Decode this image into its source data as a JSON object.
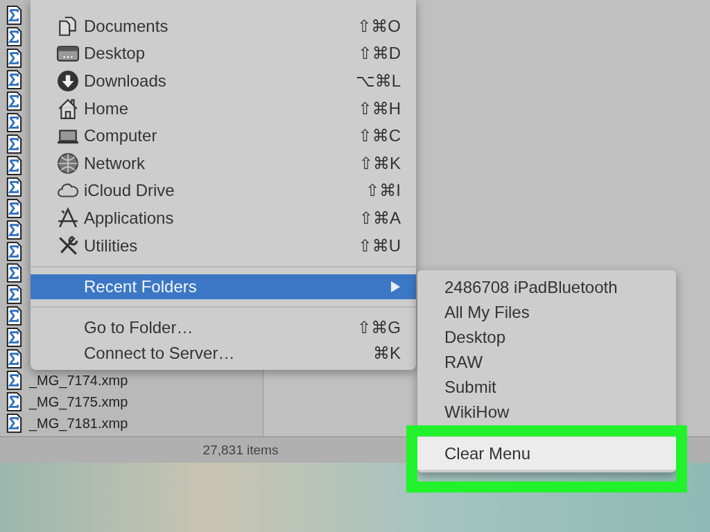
{
  "file_list": {
    "rows": [
      {
        "name": "_MG_7174.xmp"
      },
      {
        "name": "_MG_7175.xmp"
      },
      {
        "name": "_MG_7181.xmp"
      }
    ]
  },
  "status_bar": {
    "text": "27,831 items"
  },
  "go_menu": {
    "sections": [
      [
        {
          "kind": "item",
          "label": "Documents",
          "shortcut": "⇧⌘O",
          "selected": false
        },
        {
          "kind": "item",
          "label": "Desktop",
          "shortcut": "⇧⌘D",
          "selected": false
        },
        {
          "kind": "item",
          "label": "Downloads",
          "shortcut": "⌥⌘L",
          "selected": false
        },
        {
          "kind": "item",
          "label": "Home",
          "shortcut": "⇧⌘H",
          "selected": false
        },
        {
          "kind": "item",
          "label": "Computer",
          "shortcut": "⇧⌘C",
          "selected": false
        },
        {
          "kind": "item",
          "label": "Network",
          "shortcut": "⇧⌘K",
          "selected": false
        },
        {
          "kind": "item",
          "label": "iCloud Drive",
          "shortcut": "⇧⌘I",
          "selected": false
        },
        {
          "kind": "item",
          "label": "Applications",
          "shortcut": "⇧⌘A",
          "selected": false
        },
        {
          "kind": "item",
          "label": "Utilities",
          "shortcut": "⇧⌘U",
          "selected": false
        }
      ],
      [
        {
          "kind": "submenu",
          "label": "Recent Folders",
          "selected": true
        }
      ],
      [
        {
          "kind": "item",
          "label": "Go to Folder…",
          "shortcut": "⇧⌘G",
          "selected": false
        },
        {
          "kind": "item",
          "label": "Connect to Server…",
          "shortcut": "⌘K",
          "selected": false
        }
      ]
    ]
  },
  "recent_folders_menu": {
    "items": [
      {
        "label": "2486708 iPadBluetooth",
        "selected": false
      },
      {
        "label": "All My Files",
        "selected": false
      },
      {
        "label": "Desktop",
        "selected": false
      },
      {
        "label": "RAW",
        "selected": false
      },
      {
        "label": "Submit",
        "selected": false
      },
      {
        "label": "WikiHow",
        "selected": false
      }
    ],
    "footer": [
      {
        "label": "Clear Menu",
        "selected": true
      }
    ]
  }
}
